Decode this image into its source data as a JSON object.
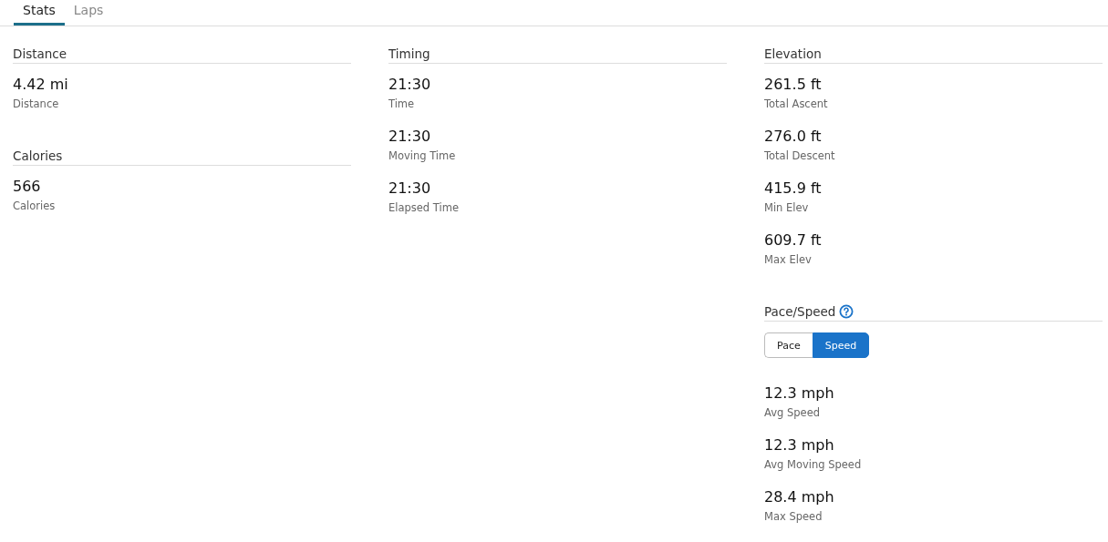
{
  "tabs": [
    {
      "label": "Stats",
      "selected": true
    },
    {
      "label": "Laps",
      "selected": false
    }
  ],
  "columns": [
    {
      "sections": [
        {
          "title": "Distance",
          "stats": [
            {
              "value": "4.42 mi",
              "label": "Distance"
            }
          ]
        },
        {
          "title": "Calories",
          "stats": [
            {
              "value": "566",
              "label": "Calories"
            }
          ]
        }
      ]
    },
    {
      "sections": [
        {
          "title": "Timing",
          "stats": [
            {
              "value": "21:30",
              "label": "Time"
            },
            {
              "value": "21:30",
              "label": "Moving Time"
            },
            {
              "value": "21:30",
              "label": "Elapsed Time"
            }
          ]
        }
      ]
    },
    {
      "sections": [
        {
          "title": "Elevation",
          "stats": [
            {
              "value": "261.5 ft",
              "label": "Total Ascent"
            },
            {
              "value": "276.0 ft",
              "label": "Total Descent"
            },
            {
              "value": "415.9 ft",
              "label": "Min Elev"
            },
            {
              "value": "609.7 ft",
              "label": "Max Elev"
            }
          ]
        },
        {
          "title": "Pace/Speed",
          "help": true,
          "toggle": [
            {
              "label": "Pace",
              "selected": false
            },
            {
              "label": "Speed",
              "selected": true
            }
          ],
          "stats": [
            {
              "value": "12.3 mph",
              "label": "Avg Speed"
            },
            {
              "value": "12.3 mph",
              "label": "Avg Moving Speed"
            },
            {
              "value": "28.4 mph",
              "label": "Max Speed"
            }
          ]
        }
      ]
    }
  ]
}
